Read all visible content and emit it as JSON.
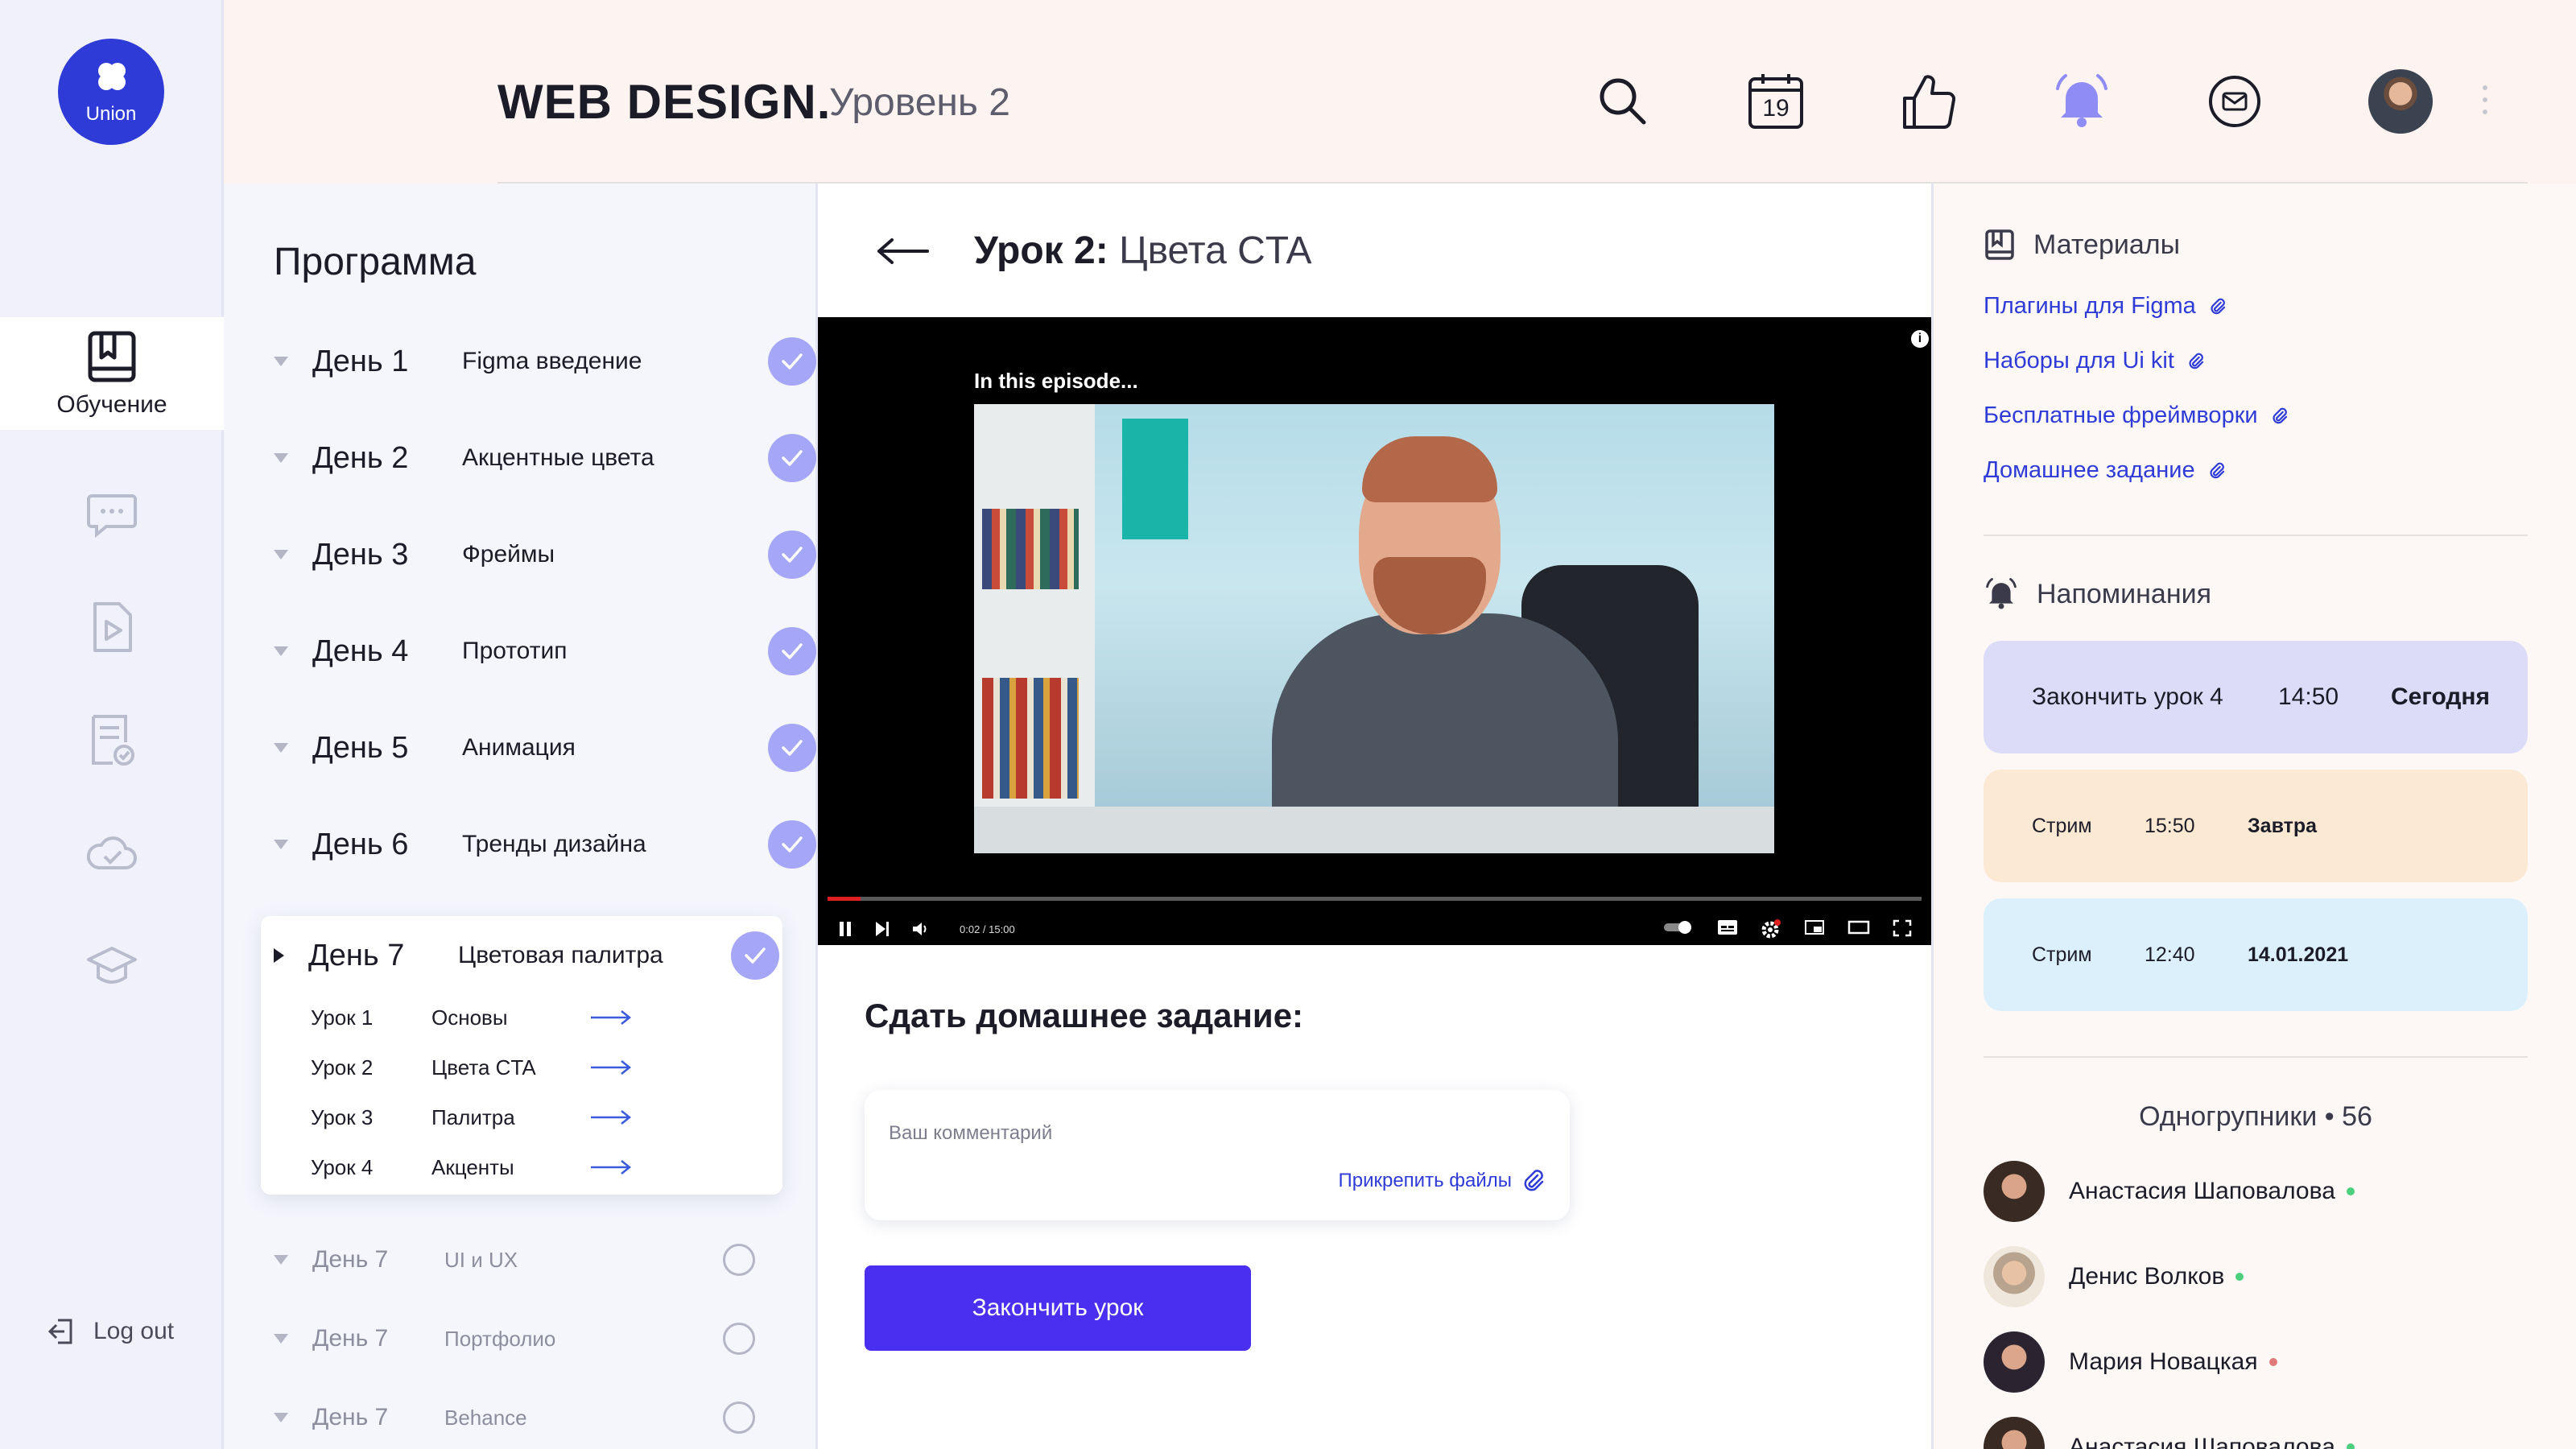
{
  "sidebar": {
    "logo_text": "Union",
    "active_item": {
      "label": "Обучение",
      "icon": "book-bookmark-icon"
    },
    "items": [
      {
        "icon": "chat-icon"
      },
      {
        "icon": "video-file-icon"
      },
      {
        "icon": "document-check-icon"
      },
      {
        "icon": "cloud-check-icon"
      },
      {
        "icon": "graduation-cap-icon"
      }
    ],
    "logout_label": "Log out"
  },
  "header": {
    "title": "WEB DESIGN.",
    "level": "Уровень 2",
    "calendar_day": "19",
    "icons": [
      "search-icon",
      "calendar-icon",
      "thumbs-up-icon",
      "bell-icon",
      "mail-icon"
    ]
  },
  "program": {
    "title": "Программа",
    "days": [
      {
        "name": "День 1",
        "topic": "Figma введение",
        "done": true
      },
      {
        "name": "День 2",
        "topic": "Акцентные цвета",
        "done": true
      },
      {
        "name": "День 3",
        "topic": "Фреймы",
        "done": true
      },
      {
        "name": "День 4",
        "topic": "Прототип",
        "done": true
      },
      {
        "name": "День 5",
        "topic": "Анимация",
        "done": true
      },
      {
        "name": "День 6",
        "topic": "Тренды дизайна",
        "done": true
      }
    ],
    "expanded": {
      "name": "День 7",
      "topic": "Цветовая палитра",
      "lessons": [
        {
          "name": "Урок 1",
          "topic": "Основы"
        },
        {
          "name": "Урок 2",
          "topic": "Цвета CTA"
        },
        {
          "name": "Урок 3",
          "topic": "Палитра"
        },
        {
          "name": "Урок 4",
          "topic": "Акценты"
        }
      ]
    },
    "upcoming": [
      {
        "name": "День 7",
        "topic": "UI и UX"
      },
      {
        "name": "День 7",
        "topic": "Портфолио"
      },
      {
        "name": "День 7",
        "topic": "Behance"
      }
    ]
  },
  "lesson": {
    "title_prefix": "Урок 2:",
    "title_name": "Цвета CTA",
    "video": {
      "episode_label": "In this episode...",
      "time": "0:02 / 15:00",
      "progress": 0.03
    },
    "homework_title": "Сдать домашнее задание:",
    "comment_placeholder": "Ваш комментарий",
    "attach_label": "Прикрепить файлы",
    "finish_button": "Закончить урок"
  },
  "materials": {
    "title": "Материалы",
    "links": [
      "Плагины для Figma",
      "Наборы для Ui kit",
      "Бесплатные фреймворки",
      "Домашнее задание"
    ]
  },
  "reminders": {
    "title": "Напоминания",
    "items": [
      {
        "text": "Закончить урок 4",
        "time": "14:50",
        "day": "Сегодня",
        "color": "#dcdcf9"
      },
      {
        "text": "Стрим",
        "time": "15:50",
        "day": "Завтра",
        "color": "#fce9d4"
      },
      {
        "text": "Стрим",
        "time": "12:40",
        "day": "14.01.2021",
        "color": "#dcf0fc"
      }
    ]
  },
  "classmates": {
    "title": "Одногрупники • 56",
    "members": [
      {
        "name": "Анастасия Шаповалова",
        "status_color": "#4cd07d"
      },
      {
        "name": "Денис Волков",
        "status_color": "#4cd07d"
      },
      {
        "name": "Мария Новацкая",
        "status_color": "#e07a7a"
      },
      {
        "name": "Анастасия Шаповалова",
        "status_color": "#4cd07d"
      }
    ]
  },
  "colors": {
    "accent": "#4b2ff0",
    "check": "#a5a6f6",
    "link": "#2f3bd6",
    "logo": "#2f3bd6"
  }
}
